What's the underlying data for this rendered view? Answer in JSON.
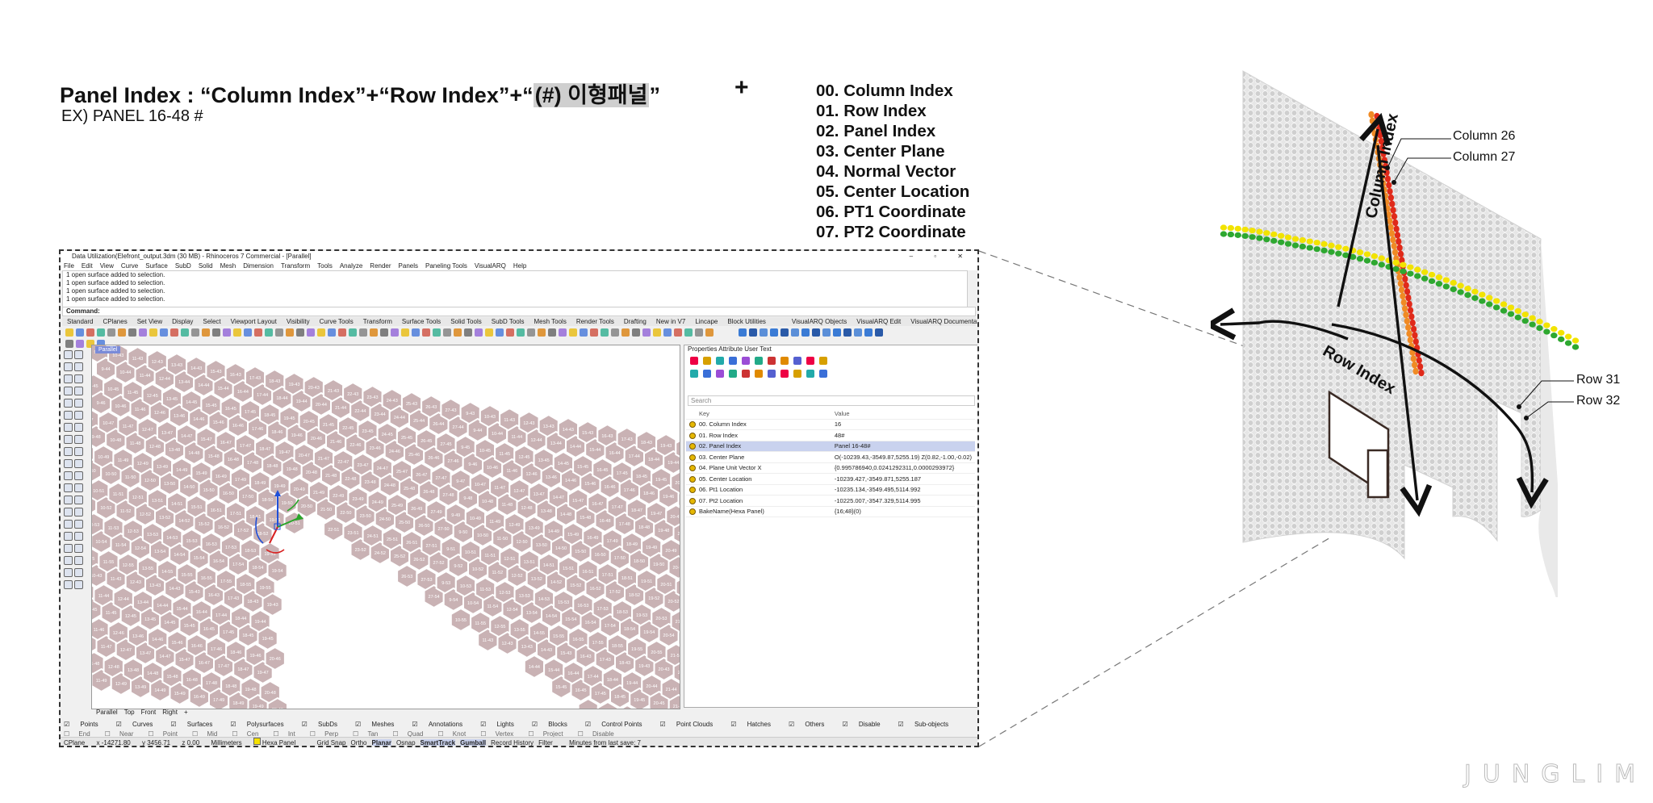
{
  "headline": {
    "prefix": "Panel Index : “Column Index”+“Row Index”+“",
    "highlight": "(#) 이형패널",
    "suffix": "”",
    "example": "EX) PANEL 16-48 #",
    "plus": "+"
  },
  "key_list": [
    "00. Column Index",
    "01. Row Index",
    "02. Panel Index",
    "03. Center Plane",
    "04. Normal Vector",
    "05. Center Location",
    "06. PT1 Coordinate",
    "07. PT2 Coordinate"
  ],
  "rhino": {
    "window_title": "Data Utilization(Elefront_output.3dm (30 MB) - Rhinoceros 7 Commercial - [Parallel]",
    "window_controls": "– ▫ ✕",
    "menu": [
      "File",
      "Edit",
      "View",
      "Curve",
      "Surface",
      "SubD",
      "Solid",
      "Mesh",
      "Dimension",
      "Transform",
      "Tools",
      "Analyze",
      "Render",
      "Panels",
      "Paneling Tools",
      "VisualARQ",
      "Help"
    ],
    "console_lines": [
      "1 open surface added to selection.",
      "1 open surface added to selection.",
      "1 open surface added to selection.",
      "1 open surface added to selection."
    ],
    "command_prompt": "Command:",
    "toolbar_tabs": [
      "Standard",
      "CPlanes",
      "Set View",
      "Display",
      "Select",
      "Viewport Layout",
      "Visibility",
      "Curve Tools",
      "Transform",
      "Surface Tools",
      "Solid Tools",
      "SubD Tools",
      "Mesh Tools",
      "Render Tools",
      "Drafting",
      "New in V7",
      "Lincape",
      "Block Utilities"
    ],
    "toolbar_tabs_right": [
      "VisualARQ Objects",
      "VisualARQ Edit",
      "VisualARQ Documentation",
      "VisualARQ Tools"
    ],
    "viewport_label": "Parallel",
    "view_tabs": [
      "Parallel",
      "Top",
      "Front",
      "Right",
      "+"
    ],
    "properties_header": "Properties  Attribute User Text",
    "search_placeholder": "Search",
    "table_headers": {
      "key": "Key",
      "value": "Value"
    },
    "attributes": [
      {
        "key": "00. Column Index",
        "value": "16"
      },
      {
        "key": "01. Row Index",
        "value": "48#"
      },
      {
        "key": "02. Panel Index",
        "value": "Panel 16-48#",
        "selected": true
      },
      {
        "key": "03. Center Plane",
        "value": "O(-10239.43,-3549.87,5255.19) Z(0.82,-1.00,-0.02)"
      },
      {
        "key": "04. Plane Unit Vector X",
        "value": "{0.995786940,0.0241292311,0.0000293972}"
      },
      {
        "key": "05. Center Location",
        "value": "-10239.427,-3549.871,5255.187"
      },
      {
        "key": "06. Pt1 Location",
        "value": "-10235.134,-3549.495,5114.992"
      },
      {
        "key": "07. Pt2 Location",
        "value": "-10225.007,-3547.329,5114.995"
      },
      {
        "key": "BakeName(Hexa Panel)",
        "value": "{16;48}(0)"
      }
    ],
    "osnap_row": [
      "Points",
      "Curves",
      "Surfaces",
      "Polysurfaces",
      "SubDs",
      "Meshes",
      "Annotations",
      "Lights",
      "Blocks",
      "Control Points",
      "Point Clouds",
      "Hatches",
      "Others",
      "Disable",
      "Sub-objects"
    ],
    "osnap_row2": [
      "End",
      "Near",
      "Point",
      "Mid",
      "Cen",
      "Int",
      "Perp",
      "Tan",
      "Quad",
      "Knot",
      "Vertex",
      "Project",
      "Disable"
    ],
    "status_bar": {
      "cplane": "CPlane",
      "x": "x -14271.80",
      "y": "y 3456.71",
      "z": "z 0.00",
      "units": "Millimeters",
      "layer": "Hexa Panel",
      "toggles": [
        "Grid Snap",
        "Ortho",
        "Planar",
        "Osnap",
        "SmartTrack",
        "Gumball",
        "Record History",
        "Filter"
      ],
      "active_toggles": [
        "Planar",
        "SmartTrack",
        "Gumball"
      ],
      "message": "Minutes from last save: 7"
    },
    "hex_row_labels": [
      "9",
      "10",
      "11",
      "12",
      "13",
      "14",
      "15",
      "16",
      "17",
      "18",
      "19",
      "20",
      "21",
      "22",
      "23",
      "24",
      "25",
      "26",
      "27"
    ],
    "hex_col_labels": [
      "43",
      "44",
      "45",
      "46",
      "47",
      "48",
      "49",
      "50",
      "51",
      "52",
      "53",
      "54",
      "55"
    ]
  },
  "diagram": {
    "column_axis_label": "Column Index",
    "row_axis_label": "Row Index",
    "callouts": [
      "Column 26",
      "Column 27",
      "Row 31",
      "Row 32"
    ],
    "colors": {
      "column_26": "#f08a24",
      "column_27": "#e02a1a",
      "row_31": "#f2e300",
      "row_32": "#2ea830",
      "panel": "#d8d8d8"
    }
  },
  "watermark": "JUNGLIM"
}
